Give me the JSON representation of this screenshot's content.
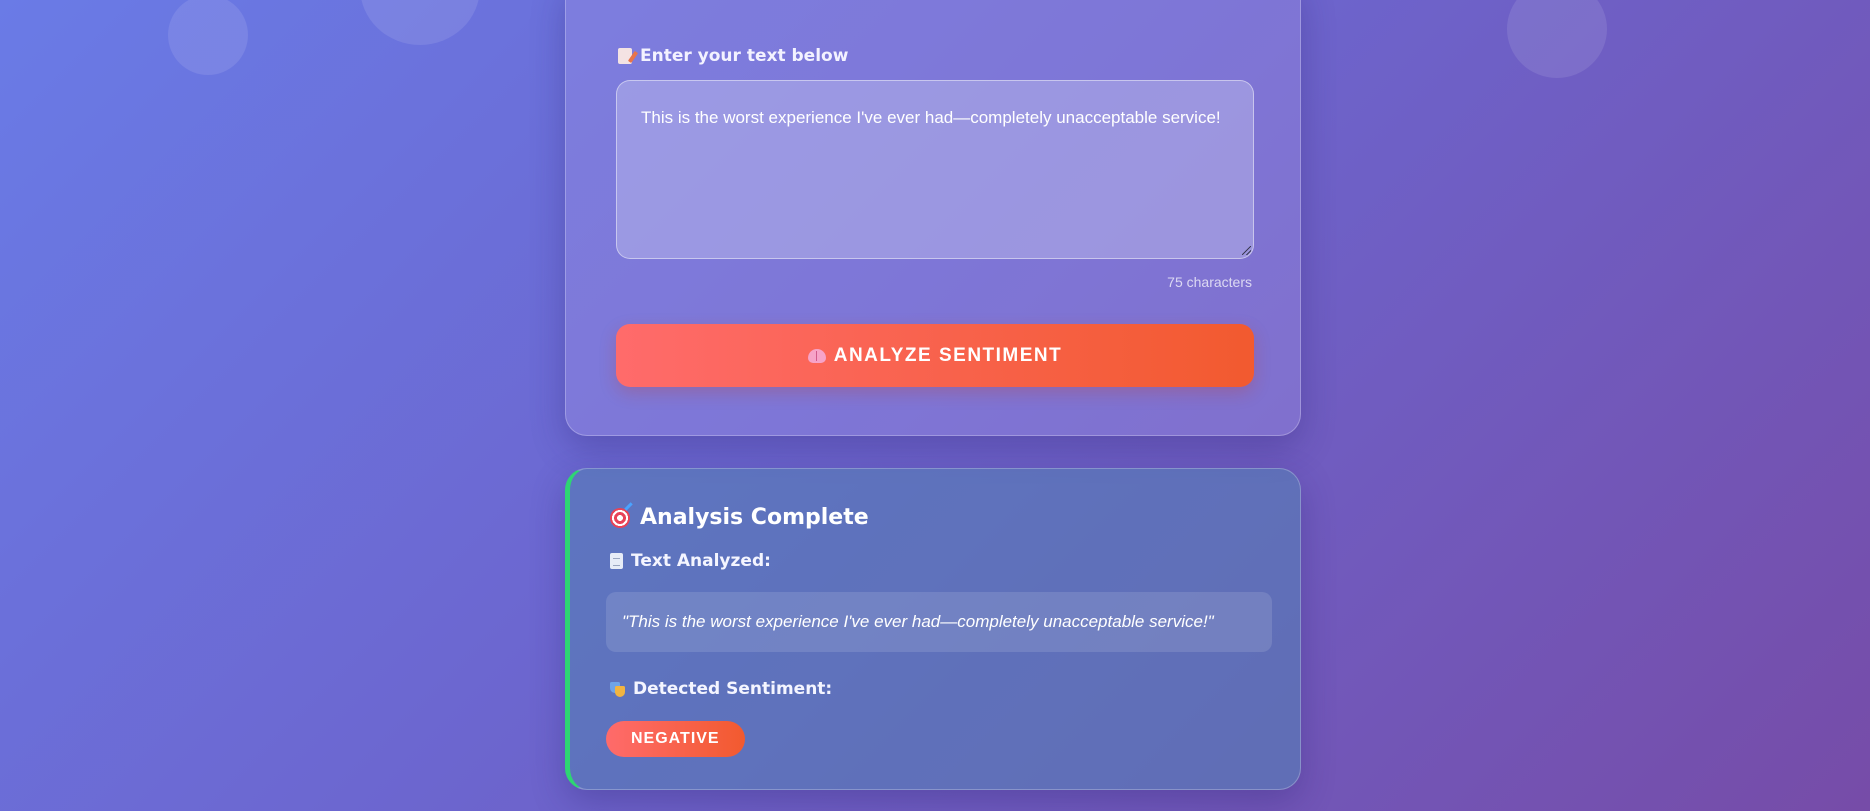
{
  "input_card": {
    "label": "Enter your text below",
    "label_icon": "memo-icon",
    "text_value": "This is the worst experience I've ever had—completely unacceptable service!",
    "char_count": "75 characters",
    "analyze_label": "ANALYZE SENTIMENT",
    "analyze_icon": "brain-icon"
  },
  "result_card": {
    "title": "Analysis Complete",
    "title_icon": "target-icon",
    "text_analyzed_label": "Text Analyzed:",
    "text_analyzed_icon": "document-icon",
    "analyzed_text": "\"This is the worst experience I've ever had—completely unacceptable service!\"",
    "sentiment_label": "Detected Sentiment:",
    "sentiment_icon": "theater-masks-icon",
    "sentiment_value": "NEGATIVE"
  },
  "colors": {
    "background_start": "#6a7be6",
    "background_end": "#764ca8",
    "button_start": "#ff6b6b",
    "button_end": "#f25a2f",
    "result_accent": "#2ed573"
  }
}
